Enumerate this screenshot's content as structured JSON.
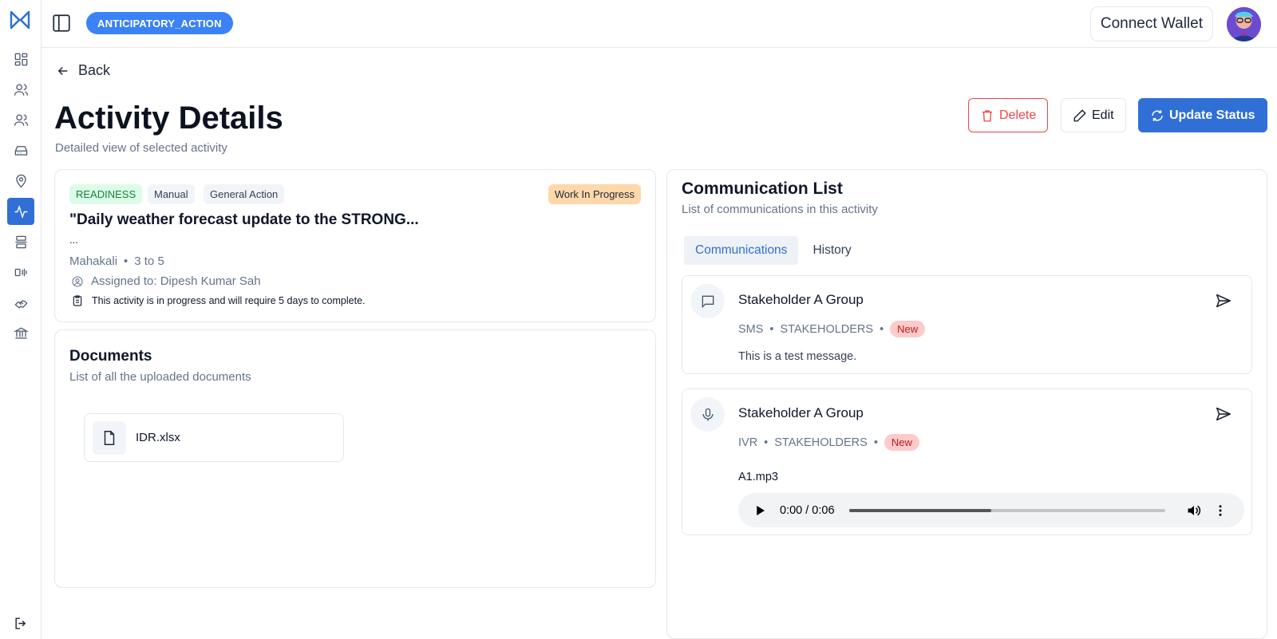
{
  "header": {
    "app_badge": "ANTICIPATORY_ACTION",
    "connect_wallet": "Connect Wallet"
  },
  "sidebar": {
    "items": [
      {
        "icon": "dashboard-icon"
      },
      {
        "icon": "users-icon"
      },
      {
        "icon": "group-icon"
      },
      {
        "icon": "inbox-icon"
      },
      {
        "icon": "location-pin-icon"
      },
      {
        "icon": "activity-icon",
        "active": true
      },
      {
        "icon": "stack-icon"
      },
      {
        "icon": "broadcast-icon"
      },
      {
        "icon": "handshake-icon"
      },
      {
        "icon": "bank-icon"
      }
    ],
    "logout_icon": "logout-icon"
  },
  "page": {
    "back_label": "Back",
    "title": "Activity Details",
    "subtitle": "Detailed view of selected activity"
  },
  "actions": {
    "delete": "Delete",
    "edit": "Edit",
    "update_status": "Update Status"
  },
  "activity": {
    "tags": [
      "READINESS",
      "Manual",
      "General Action"
    ],
    "status": "Work In Progress",
    "title": "\"Daily weather forecast update to the STRONG...",
    "ellipsis": "...",
    "location": "Mahakali",
    "separator": "•",
    "range": "3 to 5",
    "assigned": "Assigned to: Dipesh Kumar Sah",
    "note": "This activity is in progress and will require 5 days to complete."
  },
  "documents": {
    "title": "Documents",
    "subtitle": "List of all the uploaded documents",
    "files": [
      {
        "name": "IDR.xlsx"
      }
    ]
  },
  "communication": {
    "title": "Communication List",
    "subtitle": "List of communications in this activity",
    "tabs": [
      {
        "label": "Communications",
        "active": true
      },
      {
        "label": "History",
        "active": false
      }
    ],
    "items": [
      {
        "icon": "message-icon",
        "name": "Stakeholder A Group",
        "channel": "SMS",
        "audience": "STAKEHOLDERS",
        "status": "New",
        "message": "This is a test message."
      },
      {
        "icon": "microphone-icon",
        "name": "Stakeholder A Group",
        "channel": "IVR",
        "audience": "STAKEHOLDERS",
        "status": "New",
        "file": "A1.mp3",
        "audio_time": "0:00 / 0:06",
        "audio_progress": 0.45
      }
    ]
  },
  "colors": {
    "primary": "#2f6fd6",
    "danger": "#ef4444",
    "badge_blue": "#3b82f6",
    "wip": "#fed7aa"
  }
}
